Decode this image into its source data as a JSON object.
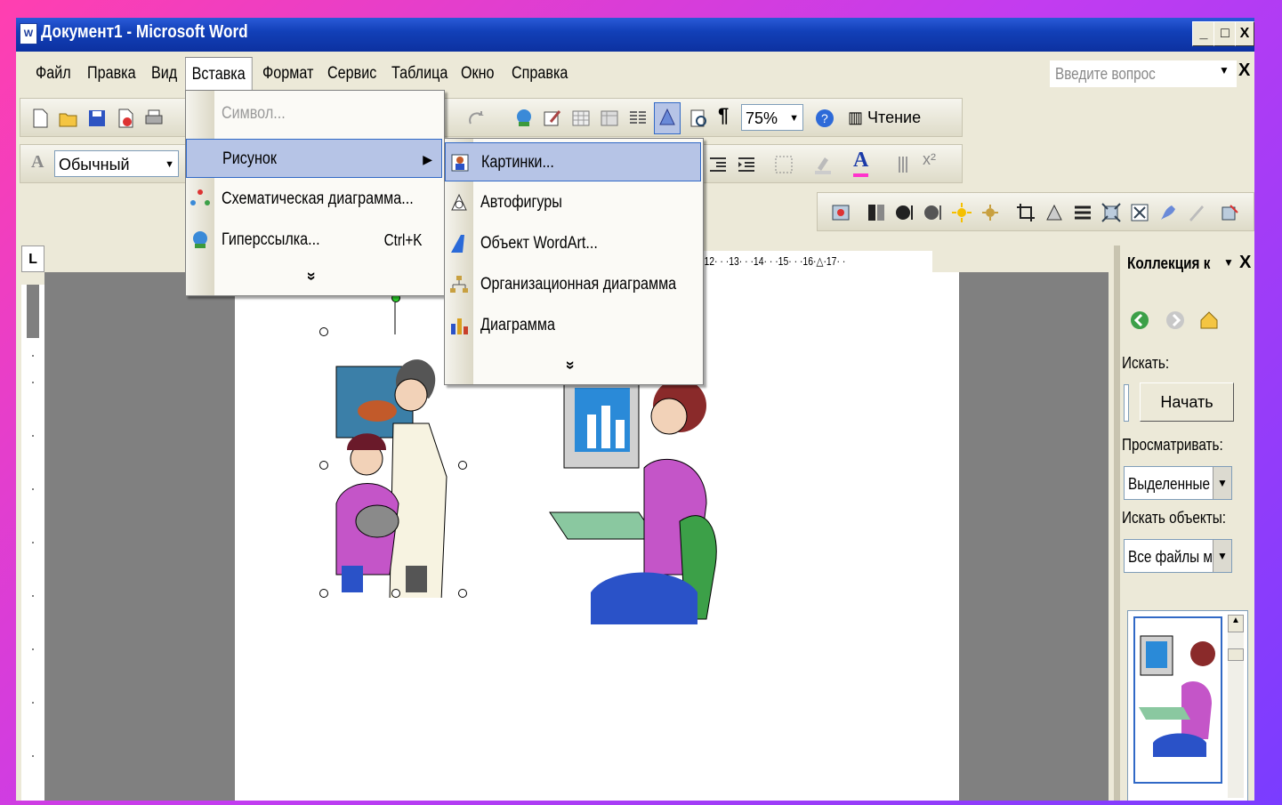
{
  "window": {
    "title": "Документ1 - Microsoft Word",
    "controls": {
      "minimize": "_",
      "maximize": "□",
      "close": "X"
    }
  },
  "menubar": {
    "items": [
      "Файл",
      "Правка",
      "Вид",
      "Вставка",
      "Формат",
      "Сервис",
      "Таблица",
      "Окно",
      "Справка"
    ],
    "open_item": "Вставка",
    "ask_placeholder": "Введите вопрос",
    "ask_close": "X"
  },
  "toolbar": {
    "zoom": "75%",
    "reading_label": "Чтение",
    "style_value": "Обычный",
    "style_icon_letter": "A"
  },
  "insert_menu": {
    "items": [
      {
        "label": "Символ...",
        "disabled": true
      },
      {
        "label": "Рисунок",
        "has_submenu": true,
        "highlighted": true
      },
      {
        "label": "Схематическая диаграмма..."
      },
      {
        "label": "Гиперссылка...",
        "shortcut": "Ctrl+K"
      }
    ],
    "expand": "»"
  },
  "picture_submenu": {
    "items": [
      {
        "label": "Картинки...",
        "highlighted": true
      },
      {
        "label": "Автофигуры"
      },
      {
        "label": "Объект WordArt..."
      },
      {
        "label": "Организационная диаграмма"
      },
      {
        "label": "Диаграмма"
      }
    ],
    "expand": "»"
  },
  "ruler": {
    "corner": "L",
    "horizontal_marks": "·12· · ·13· · ·14· · ·15· · ·16·△·17· ·"
  },
  "task_pane": {
    "title": "Коллекция к",
    "search_label": "Искать:",
    "start_button": "Начать",
    "browse_label": "Просматривать:",
    "browse_value": "Выделенные",
    "objects_label": "Искать объекты:",
    "objects_value": "Все файлы му",
    "close": "X"
  },
  "colors": {
    "title_bar": "#1240b8",
    "menu_highlight": "#b6c4e6",
    "chrome": "#ece9d8",
    "workspace": "#808080"
  },
  "icons": [
    "new-doc-icon",
    "open-folder-icon",
    "save-icon",
    "permission-icon",
    "print-icon",
    "redo-icon",
    "hyperlink-icon",
    "drawing-icon",
    "table-icon",
    "excel-icon",
    "columns-icon",
    "document-map-icon",
    "paragraph-icon",
    "help-icon",
    "reading-icon",
    "clipart-icon",
    "autoshapes-icon",
    "wordart-icon",
    "org-chart-icon",
    "chart-icon",
    "back-icon",
    "forward-icon",
    "home-icon"
  ]
}
